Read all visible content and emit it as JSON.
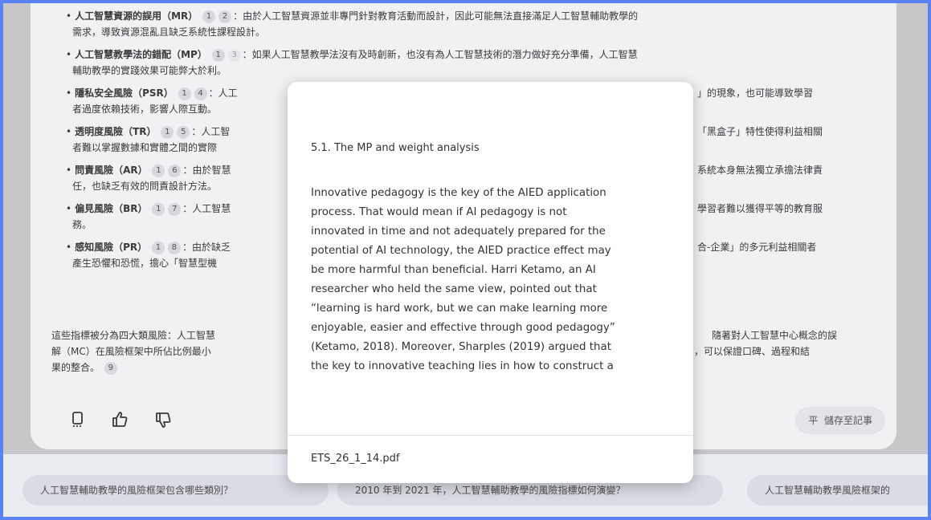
{
  "bullets": [
    {
      "line1_pre": "人工智慧資源的誤用（MR）",
      "cites": [
        "1",
        "2"
      ],
      "line1_post": "：由於人工智慧資源並非專門針對教育活動而設計，因此可能無法直接滿足人工智慧輔助教學的",
      "line2": "需求，導致資源混亂且缺乏系統性課程設計。"
    },
    {
      "line1_pre": "人工智慧教學法的錯配（MP）",
      "cites": [
        "1",
        "3"
      ],
      "line1_post": "：如果人工智慧教學法沒有及時創新，也沒有為人工智慧技術的潛力做好充分準備，人工智慧",
      "line2": "輔助教學的實踐效果可能弊大於利。"
    },
    {
      "line1_pre": "隱私安全風險（PSR）",
      "cites": [
        "1",
        "4"
      ],
      "line1_post": "：人工",
      "line1_right": "」的現象，也可能導致學習",
      "line2": "者過度依賴技術，影響人際互動。"
    },
    {
      "line1_pre": "透明度風險（TR）",
      "cites": [
        "1",
        "5"
      ],
      "line1_post": "：人工智",
      "line1_right": "「黑盒子」特性使得利益相關",
      "line2": "者難以掌握數據和實體之間的實際"
    },
    {
      "line1_pre": "問責風險（AR）",
      "cites": [
        "1",
        "6"
      ],
      "line1_post": "：由於智慧",
      "line1_right": "系統本身無法獨立承擔法律責",
      "line2": "任，也缺乏有效的問責設計方法。"
    },
    {
      "line1_pre": "偏見風險（BR）",
      "cites": [
        "1",
        "7"
      ],
      "line1_post": "：人工智慧",
      "line1_right": "學習者難以獲得平等的教育服",
      "line2": "務。"
    },
    {
      "line1_pre": "感知風險（PR）",
      "cites": [
        "1",
        "8"
      ],
      "line1_post": "：由於缺乏",
      "line1_right": "合-企業」的多元利益相關者",
      "line2": "產生恐懼和恐慌，擔心「智慧型機"
    }
  ],
  "summary": {
    "line1_left": "這些指標被分為四大類風險：人工智慧",
    "line1_right": "隨著對人工智慧中心概念的誤",
    "line2_left": "解（MC）在風險框架中所佔比例最小",
    "line2_right": "，可以保證口碑、過程和結",
    "line3": "果的整合。",
    "cite": "9"
  },
  "actions": {
    "copy_icon": "copy-icon",
    "like_icon": "thumbs-up-icon",
    "dislike_icon": "thumbs-down-icon",
    "save_note_icon_glyph": "平",
    "save_note_label": "儲存至記事"
  },
  "suggestions": [
    "人工智慧輔助教學的風險框架包含哪些類別？",
    "2010 年到 2021 年，人工智慧輔助教學的風險指標如何演變？",
    "人工智慧輔助教學風險框架的"
  ],
  "popup": {
    "title": "5.1. The MP and weight analysis",
    "body_lines": [
      "Innovative pedagogy is the key of the AIED application",
      "process. That would mean if AI pedagogy is not",
      "innovated in time and not adequately prepared for the",
      "potential of AI technology, the AIED practice effect may",
      "be more harmful than beneficial. Harri Ketamo, an AI",
      "researcher who held the same view, pointed out that",
      "“learning is hard work, but we can make learning more",
      "enjoyable, easier and effective through good pedagogy”",
      "(Ketamo, 2018). Moreover, Sharples (2019) argued that",
      "the key to innovative teaching lies in how to construct a"
    ],
    "source": "ETS_26_1_14.pdf"
  }
}
